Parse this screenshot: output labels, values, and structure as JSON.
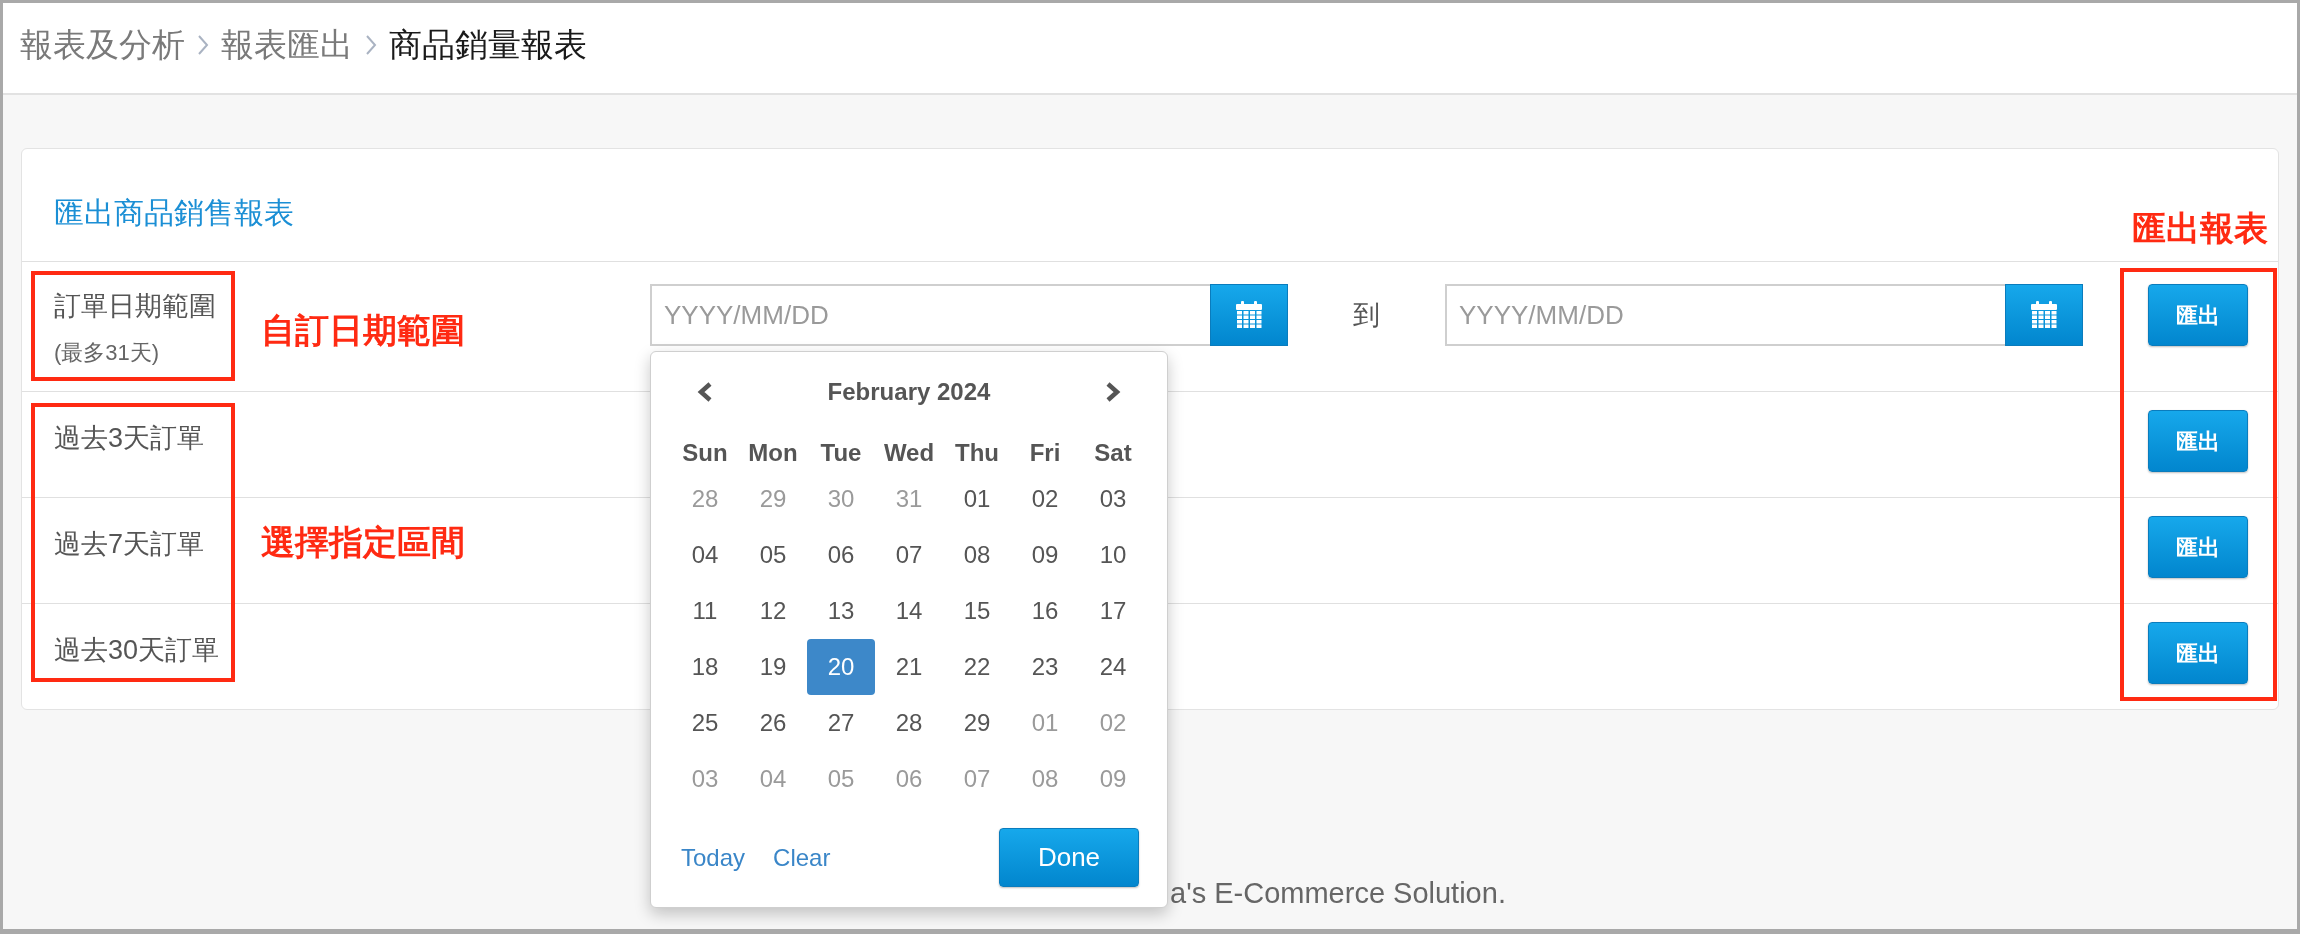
{
  "breadcrumb": [
    {
      "label": "報表及分析",
      "current": false
    },
    {
      "label": "報表匯出",
      "current": false
    },
    {
      "label": "商品銷量報表",
      "current": true
    }
  ],
  "card": {
    "title": "匯出商品銷售報表",
    "annotation": "匯出報表",
    "rows": [
      {
        "kind": "custom_range",
        "label": "訂單日期範圍",
        "note": "(最多31天)",
        "annotation": "自訂日期範圍",
        "start": {
          "placeholder": "YYYY/MM/DD"
        },
        "separator": "到",
        "end": {
          "placeholder": "YYYY/MM/DD"
        },
        "button": "匯出"
      },
      {
        "kind": "preset",
        "label": "過去3天訂單",
        "button": "匯出"
      },
      {
        "kind": "preset",
        "label": "過去7天訂單",
        "annotation": "選擇指定區間",
        "button": "匯出"
      },
      {
        "kind": "preset",
        "label": "過去30天訂單",
        "button": "匯出"
      }
    ]
  },
  "datepicker": {
    "title": "February 2024",
    "weekdays": [
      "Sun",
      "Mon",
      "Tue",
      "Wed",
      "Thu",
      "Fri",
      "Sat"
    ],
    "weeks": [
      [
        {
          "day": "28",
          "other_month": true,
          "selected": false
        },
        {
          "day": "29",
          "other_month": true,
          "selected": false
        },
        {
          "day": "30",
          "other_month": true,
          "selected": false
        },
        {
          "day": "31",
          "other_month": true,
          "selected": false
        },
        {
          "day": "01",
          "other_month": false,
          "selected": false
        },
        {
          "day": "02",
          "other_month": false,
          "selected": false
        },
        {
          "day": "03",
          "other_month": false,
          "selected": false
        }
      ],
      [
        {
          "day": "04",
          "other_month": false,
          "selected": false
        },
        {
          "day": "05",
          "other_month": false,
          "selected": false
        },
        {
          "day": "06",
          "other_month": false,
          "selected": false
        },
        {
          "day": "07",
          "other_month": false,
          "selected": false
        },
        {
          "day": "08",
          "other_month": false,
          "selected": false
        },
        {
          "day": "09",
          "other_month": false,
          "selected": false
        },
        {
          "day": "10",
          "other_month": false,
          "selected": false
        }
      ],
      [
        {
          "day": "11",
          "other_month": false,
          "selected": false
        },
        {
          "day": "12",
          "other_month": false,
          "selected": false
        },
        {
          "day": "13",
          "other_month": false,
          "selected": false
        },
        {
          "day": "14",
          "other_month": false,
          "selected": false
        },
        {
          "day": "15",
          "other_month": false,
          "selected": false
        },
        {
          "day": "16",
          "other_month": false,
          "selected": false
        },
        {
          "day": "17",
          "other_month": false,
          "selected": false
        }
      ],
      [
        {
          "day": "18",
          "other_month": false,
          "selected": false
        },
        {
          "day": "19",
          "other_month": false,
          "selected": false
        },
        {
          "day": "20",
          "other_month": false,
          "selected": true
        },
        {
          "day": "21",
          "other_month": false,
          "selected": false
        },
        {
          "day": "22",
          "other_month": false,
          "selected": false
        },
        {
          "day": "23",
          "other_month": false,
          "selected": false
        },
        {
          "day": "24",
          "other_month": false,
          "selected": false
        }
      ],
      [
        {
          "day": "25",
          "other_month": false,
          "selected": false
        },
        {
          "day": "26",
          "other_month": false,
          "selected": false
        },
        {
          "day": "27",
          "other_month": false,
          "selected": false
        },
        {
          "day": "28",
          "other_month": false,
          "selected": false
        },
        {
          "day": "29",
          "other_month": false,
          "selected": false
        },
        {
          "day": "01",
          "other_month": true,
          "selected": false
        },
        {
          "day": "02",
          "other_month": true,
          "selected": false
        }
      ],
      [
        {
          "day": "03",
          "other_month": true,
          "selected": false
        },
        {
          "day": "04",
          "other_month": true,
          "selected": false
        },
        {
          "day": "05",
          "other_month": true,
          "selected": false
        },
        {
          "day": "06",
          "other_month": true,
          "selected": false
        },
        {
          "day": "07",
          "other_month": true,
          "selected": false
        },
        {
          "day": "08",
          "other_month": true,
          "selected": false
        },
        {
          "day": "09",
          "other_month": true,
          "selected": false
        }
      ]
    ],
    "today": "Today",
    "clear": "Clear",
    "done": "Done"
  },
  "footer": {
    "text": "a's E-Commerce Solution."
  }
}
